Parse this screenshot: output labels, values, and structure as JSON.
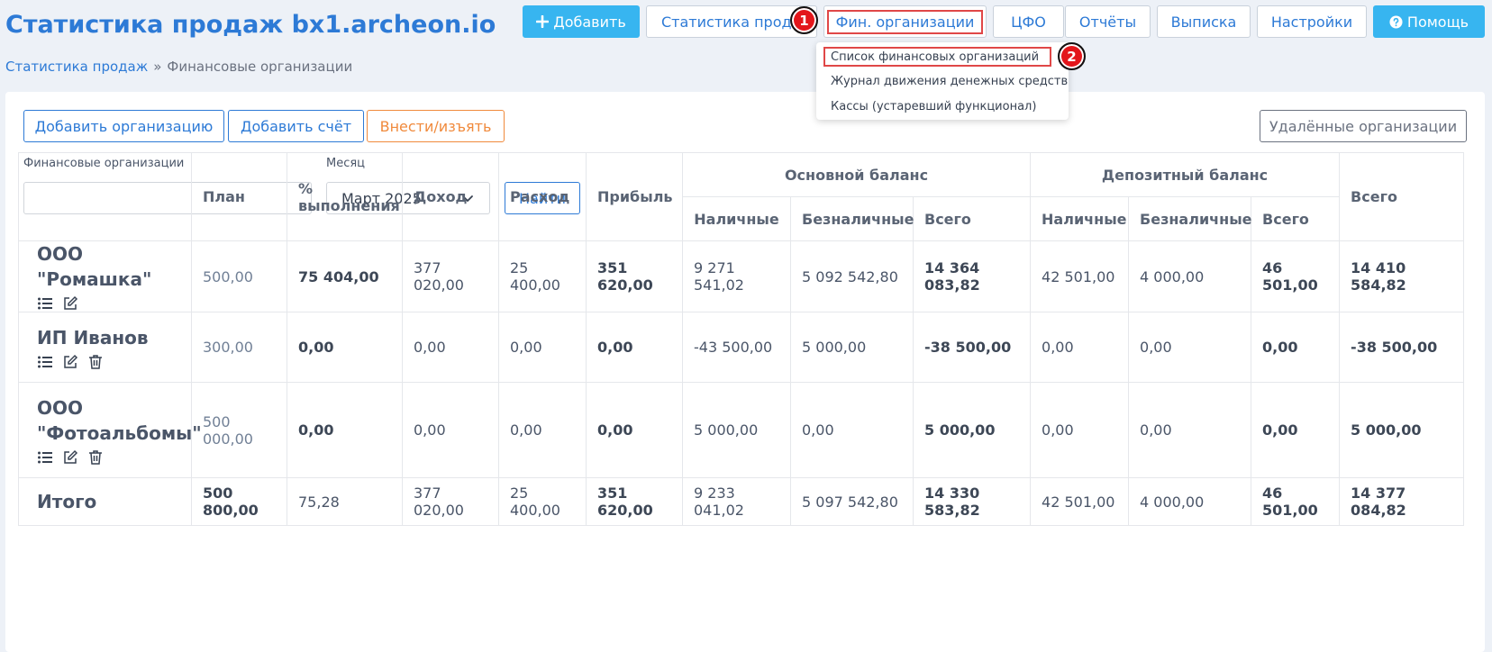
{
  "page": {
    "title": "Статистика продаж bx1.archeon.io"
  },
  "breadcrumb": {
    "parent": "Статистика продаж",
    "separator": "»",
    "current": "Финансовые организации"
  },
  "nav": {
    "add": "Добавить",
    "stats": "Статистика продаж",
    "fin": "Фин. организации",
    "cfo": "ЦФО",
    "reports": "Отчёты",
    "statement": "Выписка",
    "settings": "Настройки",
    "help": "Помощь"
  },
  "markers": {
    "m1": "1",
    "m2": "2"
  },
  "dropdown": {
    "items": [
      "Список финансовых организаций",
      "Журнал движения денежных средств",
      "Кассы (устаревший функционал)"
    ]
  },
  "toolbar": {
    "add_org": "Добавить организацию",
    "add_account": "Добавить счёт",
    "deposit_withdraw": "Внести/изъять",
    "deleted_orgs": "Удалённые организации"
  },
  "filters": {
    "org_label": "Финансовые организации",
    "org_value": "",
    "month_label": "Месяц",
    "month_value": "Март 2025",
    "find": "Найти"
  },
  "table": {
    "headers": {
      "plan": "План",
      "percent": "% выполнения",
      "income": "Доход",
      "expense": "Расход",
      "profit": "Прибыль",
      "main_balance": "Основной баланс",
      "deposit_balance": "Депозитный баланс",
      "cash": "Наличные",
      "noncash": "Безналичные",
      "total": "Всего",
      "grand_total": "Всего"
    },
    "rows": [
      {
        "name": "ООО \"Ромашка\"",
        "plan": "500,00",
        "percent": "75 404,00",
        "income": "377 020,00",
        "expense": "25 400,00",
        "profit": "351 620,00",
        "main_cash": "9 271 541,02",
        "main_noncash": "5 092 542,80",
        "main_total": "14 364 083,82",
        "dep_cash": "42 501,00",
        "dep_noncash": "4 000,00",
        "dep_total": "46 501,00",
        "total": "14 410 584,82"
      },
      {
        "name": "ИП Иванов",
        "plan": "300,00",
        "percent": "0,00",
        "income": "0,00",
        "expense": "0,00",
        "profit": "0,00",
        "main_cash": "-43 500,00",
        "main_noncash": "5 000,00",
        "main_total": "-38 500,00",
        "dep_cash": "0,00",
        "dep_noncash": "0,00",
        "dep_total": "0,00",
        "total": "-38 500,00"
      },
      {
        "name": "ООО \"Фотоальбомы\"",
        "plan": "500 000,00",
        "percent": "0,00",
        "income": "0,00",
        "expense": "0,00",
        "profit": "0,00",
        "main_cash": "5 000,00",
        "main_noncash": "0,00",
        "main_total": "5 000,00",
        "dep_cash": "0,00",
        "dep_noncash": "0,00",
        "dep_total": "0,00",
        "total": "5 000,00"
      }
    ],
    "totals": {
      "name": "Итого",
      "plan": "500 800,00",
      "percent": "75,28",
      "income": "377 020,00",
      "expense": "25 400,00",
      "profit": "351 620,00",
      "main_cash": "9 233 041,02",
      "main_noncash": "5 097 542,80",
      "main_total": "14 330 583,82",
      "dep_cash": "42 501,00",
      "dep_noncash": "4 000,00",
      "dep_total": "46 501,00",
      "total": "14 377 084,82"
    }
  },
  "colors": {
    "accent": "#2d7ad6",
    "primary_btn": "#37b5f0",
    "orange": "#f08a3c",
    "marker": "#e3161b"
  },
  "icons": [
    "plus-icon",
    "question-circle-icon",
    "list-icon",
    "edit-icon",
    "trash-icon",
    "chevron-down-icon"
  ]
}
